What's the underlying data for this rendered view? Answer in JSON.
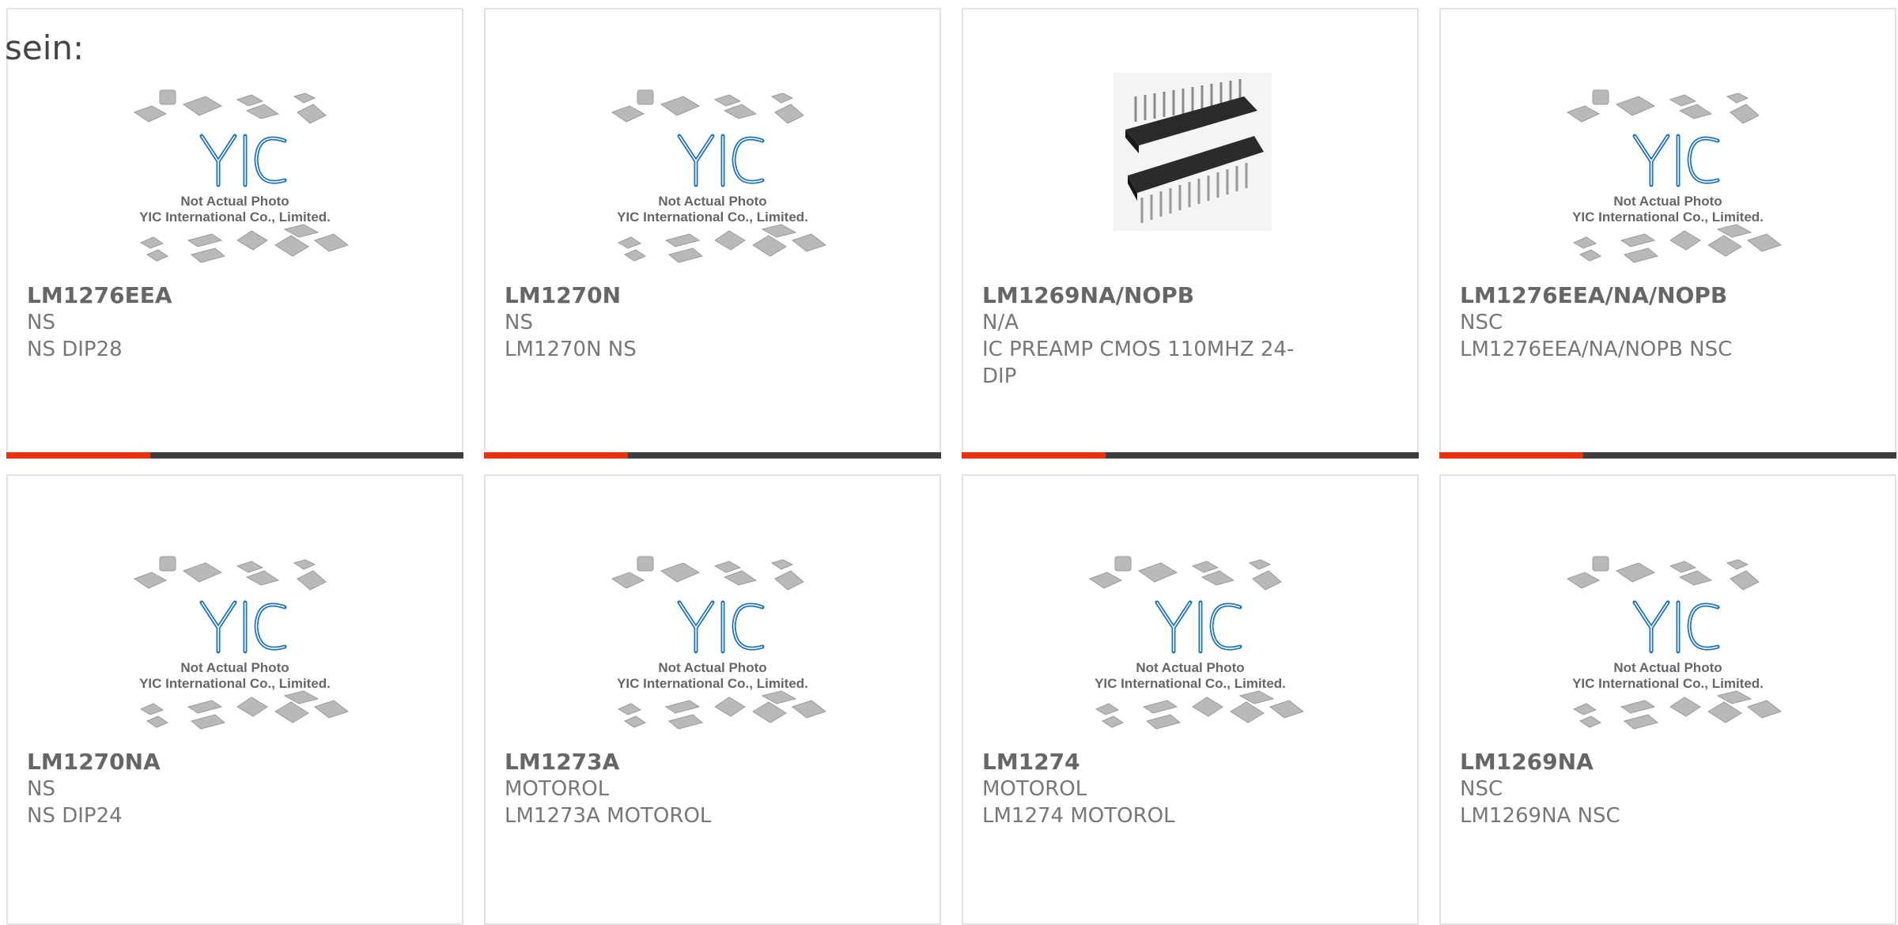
{
  "intro_text": "sein:",
  "placeholder": {
    "line1": "Not Actual Photo",
    "line2": "YIC International Co., Limited.",
    "logo": "YIC"
  },
  "colors": {
    "accent_bar": "#e8340f",
    "bar": "#3d3d3d",
    "logo_blue": "#1e73be"
  },
  "products": [
    {
      "part": "LM1276EEA",
      "maker": "NS",
      "desc": "NS DIP28",
      "image": "placeholder"
    },
    {
      "part": "LM1270N",
      "maker": "NS",
      "desc": "LM1270N NS",
      "image": "placeholder"
    },
    {
      "part": "LM1269NA/NOPB",
      "maker": "N/A",
      "desc": "IC PREAMP CMOS 110MHZ 24-DIP",
      "image": "dip-chip-photo"
    },
    {
      "part": "LM1276EEA/NA/NOPB",
      "maker": "NSC",
      "desc": "LM1276EEA/NA/NOPB NSC",
      "image": "placeholder"
    },
    {
      "part": "LM1270NA",
      "maker": "NS",
      "desc": "NS DIP24",
      "image": "placeholder"
    },
    {
      "part": "LM1273A",
      "maker": "MOTOROL",
      "desc": "LM1273A MOTOROL",
      "image": "placeholder"
    },
    {
      "part": "LM1274",
      "maker": "MOTOROL",
      "desc": "LM1274 MOTOROL",
      "image": "placeholder"
    },
    {
      "part": "LM1269NA",
      "maker": "NSC",
      "desc": "LM1269NA NSC",
      "image": "placeholder"
    }
  ]
}
